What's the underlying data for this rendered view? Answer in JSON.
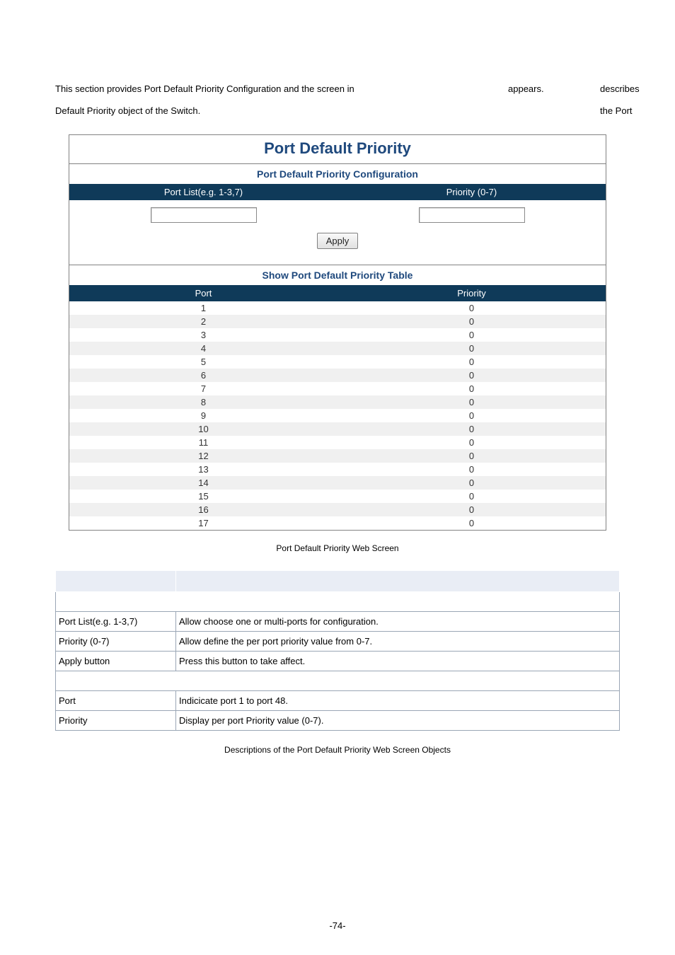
{
  "intro": {
    "line1_a": "This section provides Port Default Priority Configuration and the screen in",
    "line1_b": "appears.",
    "line1_c": "describes the Port",
    "line2": "Default Priority object of the Switch."
  },
  "screenshot": {
    "title": "Port Default Priority",
    "config_section": "Port Default Priority Configuration",
    "header_portlist": "Port List(e.g. 1-3,7)",
    "header_priority": "Priority (0-7)",
    "apply_label": "Apply",
    "table_section": "Show Port Default Priority Table",
    "col_port": "Port",
    "col_priority": "Priority",
    "rows": [
      {
        "port": "1",
        "priority": "0"
      },
      {
        "port": "2",
        "priority": "0"
      },
      {
        "port": "3",
        "priority": "0"
      },
      {
        "port": "4",
        "priority": "0"
      },
      {
        "port": "5",
        "priority": "0"
      },
      {
        "port": "6",
        "priority": "0"
      },
      {
        "port": "7",
        "priority": "0"
      },
      {
        "port": "8",
        "priority": "0"
      },
      {
        "port": "9",
        "priority": "0"
      },
      {
        "port": "10",
        "priority": "0"
      },
      {
        "port": "11",
        "priority": "0"
      },
      {
        "port": "12",
        "priority": "0"
      },
      {
        "port": "13",
        "priority": "0"
      },
      {
        "port": "14",
        "priority": "0"
      },
      {
        "port": "15",
        "priority": "0"
      },
      {
        "port": "16",
        "priority": "0"
      },
      {
        "port": "17",
        "priority": "0"
      }
    ]
  },
  "caption_figure": "Port Default Priority Web Screen",
  "obj_table": {
    "rows": [
      {
        "object": "Port List(e.g. 1-3,7)",
        "desc": "Allow choose one or multi-ports for configuration."
      },
      {
        "object": "Priority (0-7)",
        "desc": "Allow define the per port priority value from 0-7."
      },
      {
        "object": "Apply button",
        "desc": "Press this button to take affect."
      }
    ],
    "rows2": [
      {
        "object": "Port",
        "desc": "Indicicate port 1 to port 48."
      },
      {
        "object": "Priority",
        "desc": "Display per port Priority value (0-7)."
      }
    ]
  },
  "caption_table": "Descriptions of the Port Default Priority Web Screen Objects",
  "page_number": "-74-"
}
